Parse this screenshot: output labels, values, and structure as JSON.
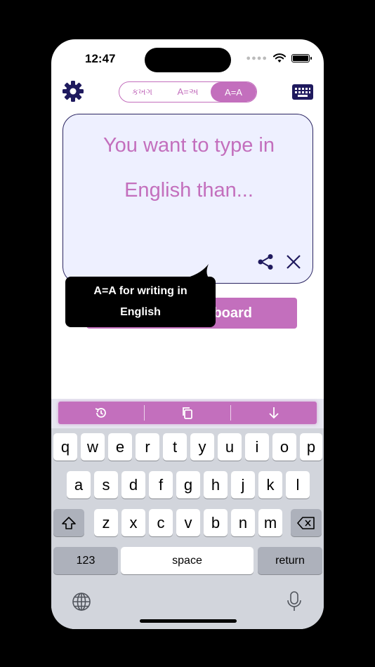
{
  "status": {
    "time": "12:47"
  },
  "header": {
    "tabs": [
      {
        "label": "કખગ",
        "active": false
      },
      {
        "label": "A=અ",
        "active": false
      },
      {
        "label": "A=A",
        "active": true
      }
    ]
  },
  "editor": {
    "line1": "You want to type in",
    "line2": "English than..."
  },
  "copy_button": {
    "label": "board"
  },
  "tooltip": {
    "line1": "A=A for writing in",
    "line2": "English"
  },
  "keyboard": {
    "row1": [
      "q",
      "w",
      "e",
      "r",
      "t",
      "y",
      "u",
      "i",
      "o",
      "p"
    ],
    "row2": [
      "a",
      "s",
      "d",
      "f",
      "g",
      "h",
      "j",
      "k",
      "l"
    ],
    "row3": [
      "z",
      "x",
      "c",
      "v",
      "b",
      "n",
      "m"
    ],
    "numbers_label": "123",
    "space_label": "space",
    "return_label": "return"
  },
  "colors": {
    "accent": "#c36fbd",
    "navy": "#1f1a5e",
    "editor_bg": "#eef0ff"
  }
}
